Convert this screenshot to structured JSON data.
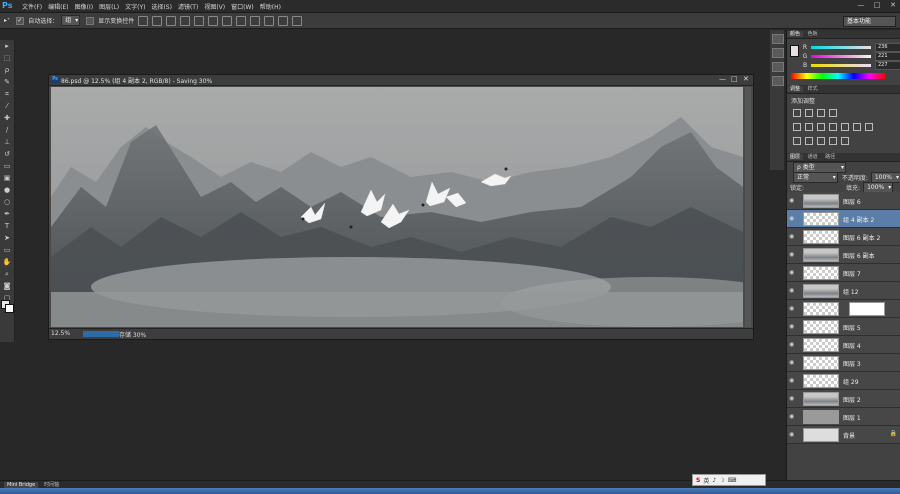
{
  "app": {
    "logo": "Ps"
  },
  "menu": [
    "文件(F)",
    "编辑(E)",
    "图像(I)",
    "图层(L)",
    "文字(Y)",
    "选择(S)",
    "滤镜(T)",
    "视图(V)",
    "窗口(W)",
    "帮助(H)"
  ],
  "window_controls": [
    "—",
    "□",
    "✕"
  ],
  "options_bar": {
    "auto_select_label": "自动选择：",
    "auto_select_value": "组",
    "show_transform_label": "显示变换控件",
    "workspace": "基本功能"
  },
  "document": {
    "title": "86.psd @ 12.5% (组 4 副本 2, RGB/8) - Saving 30%",
    "zoom": "12.5%",
    "save_status": "存储 30%",
    "save_progress": 0.3
  },
  "color_panel": {
    "tabs": [
      "颜色",
      "色板"
    ],
    "channels": [
      {
        "label": "R",
        "value": "236",
        "color": "#e04040"
      },
      {
        "label": "G",
        "value": "221",
        "color": "#40c040"
      },
      {
        "label": "B",
        "value": "227",
        "color": "#c040c0"
      }
    ]
  },
  "adjust_panel": {
    "tabs": [
      "调整",
      "样式"
    ],
    "add_label": "添加调整"
  },
  "layers_panel": {
    "tabs": [
      "图层",
      "通道",
      "路径"
    ],
    "kind_filter": "ρ 类型",
    "blend_mode": "正常",
    "opacity_label": "不透明度:",
    "opacity_value": "100%",
    "lock_label": "锁定:",
    "fill_label": "填充:",
    "fill_value": "100%",
    "layers": [
      {
        "name": "图层 6",
        "thumb": "img",
        "selected": false
      },
      {
        "name": "组 4 副本 2",
        "thumb": "trans",
        "selected": true
      },
      {
        "name": "图层 6 副本 2",
        "thumb": "trans",
        "selected": false
      },
      {
        "name": "图层 6 副本",
        "thumb": "img",
        "selected": false
      },
      {
        "name": "图层 7",
        "thumb": "trans",
        "selected": false
      },
      {
        "name": "组 12",
        "thumb": "img",
        "selected": false
      },
      {
        "name": "",
        "thumb": "trans",
        "selected": false,
        "mask": true
      },
      {
        "name": "图层 5",
        "thumb": "trans",
        "selected": false
      },
      {
        "name": "图层 4",
        "thumb": "trans",
        "selected": false
      },
      {
        "name": "图层 3",
        "thumb": "trans",
        "selected": false
      },
      {
        "name": "组 29",
        "thumb": "trans",
        "selected": false
      },
      {
        "name": "图层 2",
        "thumb": "img",
        "selected": false
      },
      {
        "name": "图层 1",
        "thumb": "grey",
        "selected": false
      },
      {
        "name": "背景",
        "thumb": "white",
        "selected": false,
        "locked": true
      }
    ]
  },
  "bottom_tabs": [
    "Mini Bridge",
    "时间轴"
  ],
  "tray": {
    "ime": "S",
    "items": [
      "英",
      "♪",
      "☽",
      "⌨"
    ]
  }
}
